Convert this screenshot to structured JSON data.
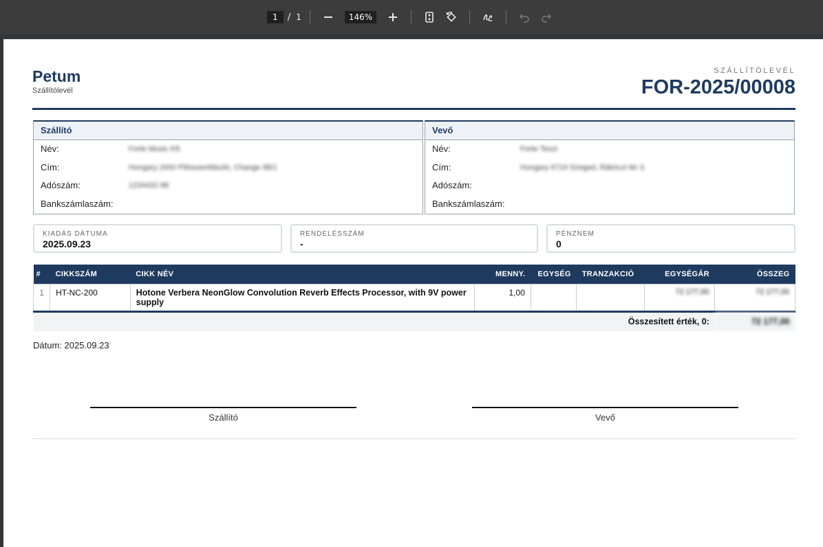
{
  "toolbar": {
    "page_current": "1",
    "page_separator": "/",
    "page_total": "1",
    "zoom": "146%",
    "icons": [
      "zoom-out-icon",
      "zoom-in-icon",
      "fit-page-icon",
      "rotate-icon",
      "draw-icon",
      "undo-icon",
      "redo-icon"
    ]
  },
  "document": {
    "company_name": "Petum",
    "company_sub": "Szállítólevél",
    "doc_type": "SZÁLLÍTÓLEVÉL",
    "doc_number": "FOR-2025/00008",
    "accent_color": "#1e3a5f"
  },
  "supplier": {
    "title": "Szállító",
    "rows": [
      {
        "label": "Név:",
        "value": "Forte Music Kft."
      },
      {
        "label": "Cím:",
        "value": "Hungary 2000 Pilisszentlászló, Change 98/1"
      },
      {
        "label": "Adószám:",
        "value": "1234432 88"
      },
      {
        "label": "Bankszámlaszám:",
        "value": ""
      }
    ]
  },
  "buyer": {
    "title": "Vevő",
    "rows": [
      {
        "label": "Név:",
        "value": "Forte Teszt"
      },
      {
        "label": "Cím:",
        "value": "Hungary 6724 Szeged, Rákóczi tér 3."
      },
      {
        "label": "Adószám:",
        "value": ""
      },
      {
        "label": "Bankszámlaszám:",
        "value": ""
      }
    ]
  },
  "info": [
    {
      "label": "KIADÁS DÁTUMA",
      "value": "2025.09.23"
    },
    {
      "label": "RENDELÉSSZÁM",
      "value": "-"
    },
    {
      "label": "PÉNZNEM",
      "value": "0"
    }
  ],
  "table": {
    "headers": [
      "#",
      "CIKKSZÁM",
      "CIKK NÉV",
      "MENNY.",
      "EGYSÉG",
      "TRANZAKCIÓ",
      "EGYSÉGÁR",
      "ÖSSZEG"
    ],
    "rows": [
      {
        "num": "1",
        "sku": "HT-NC-200",
        "name": "Hotone Verbera NeonGlow Convolution Reverb Effects Processor, with 9V power supply",
        "qty": "1,00",
        "unit": "",
        "transaction": "",
        "unit_price": "72 177,00",
        "total": "72 177,00"
      }
    ],
    "total_label": "Összesített érték, 0:",
    "total_value": "72 177,00"
  },
  "footer": {
    "date_line": "Dátum: 2025.09.23",
    "sig_left": "Szállító",
    "sig_right": "Vevő"
  }
}
